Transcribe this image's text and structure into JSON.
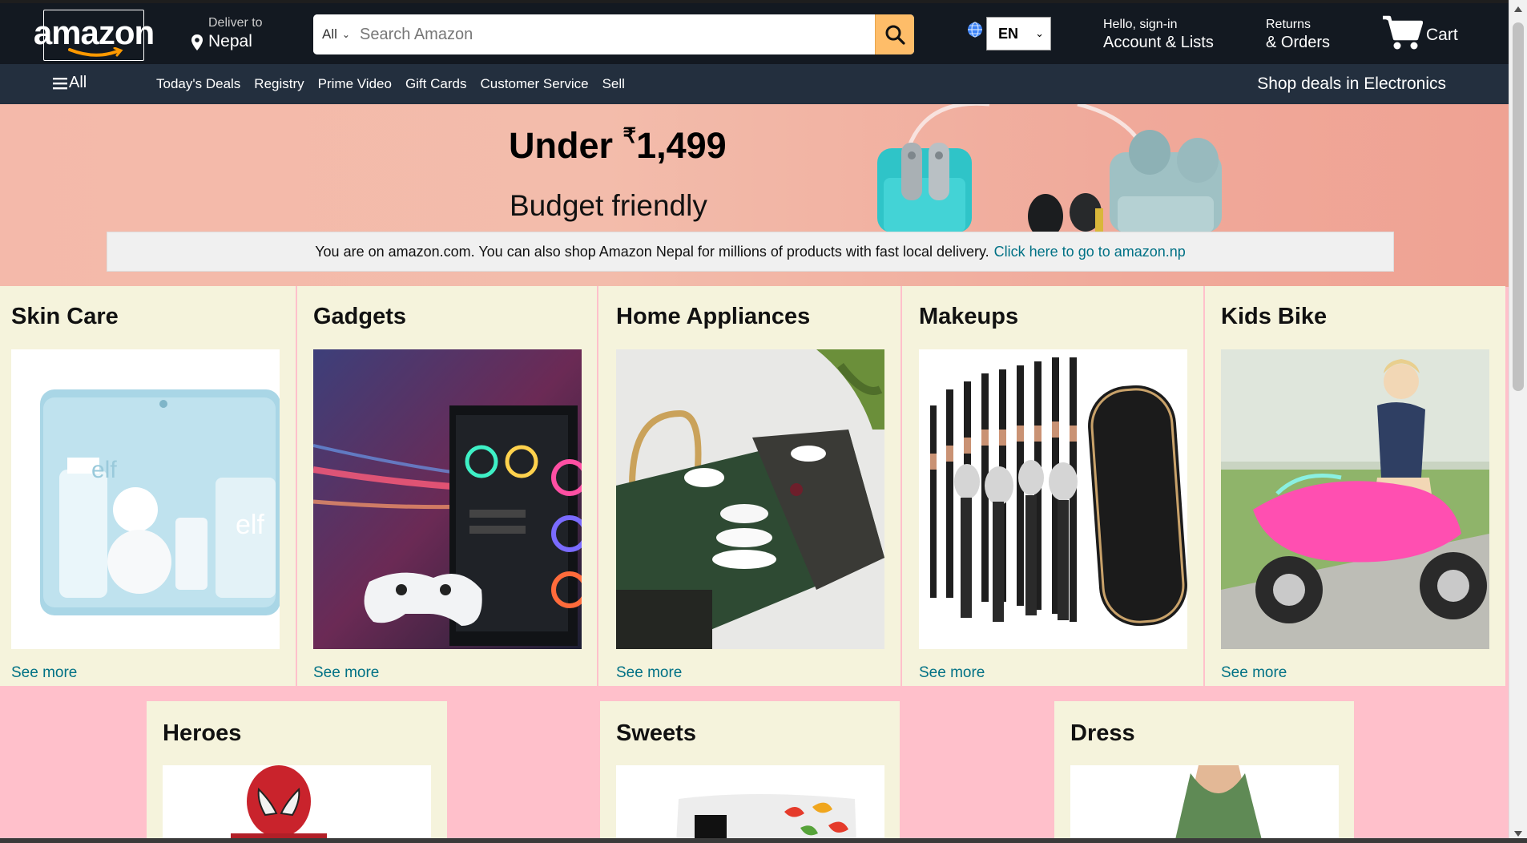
{
  "header": {
    "logo_text": "amazon",
    "deliver_line1": "Deliver to",
    "deliver_line2": "Nepal",
    "search_category": "All",
    "search_placeholder": "Search Amazon",
    "language": "EN",
    "account_line1": "Hello, sign-in",
    "account_line2": "Account & Lists",
    "returns_line1": "Returns",
    "returns_line2": "& Orders",
    "cart_label": "Cart"
  },
  "subnav": {
    "all_label": "All",
    "links": [
      "Today's Deals",
      "Registry",
      "Prime Video",
      "Gift Cards",
      "Customer Service",
      "Sell"
    ],
    "deals_label": "Shop deals in Electronics"
  },
  "hero": {
    "headline_prefix": "Under ",
    "currency": "₹",
    "price": "1,499",
    "subheadline": "Budget friendly"
  },
  "notice": {
    "text": "You are on amazon.com. You can also shop Amazon Nepal for millions of products with fast local delivery.",
    "link": "Click here to go to amazon.np"
  },
  "cards_row1": [
    {
      "title": "Skin Care",
      "more": "See more"
    },
    {
      "title": "Gadgets",
      "more": "See more"
    },
    {
      "title": "Home Appliances",
      "more": "See more"
    },
    {
      "title": "Makeups",
      "more": "See more"
    },
    {
      "title": "Kids Bike",
      "more": "See more"
    }
  ],
  "cards_row2": [
    {
      "title": "Heroes"
    },
    {
      "title": "Sweets"
    },
    {
      "title": "Dress"
    }
  ],
  "colors": {
    "nav_bg": "#131921",
    "subnav_bg": "#232f3e",
    "search_button": "#febd69",
    "link": "#007185",
    "card_bg": "#f5f3dc",
    "page_bg": "#ffc0cb"
  }
}
